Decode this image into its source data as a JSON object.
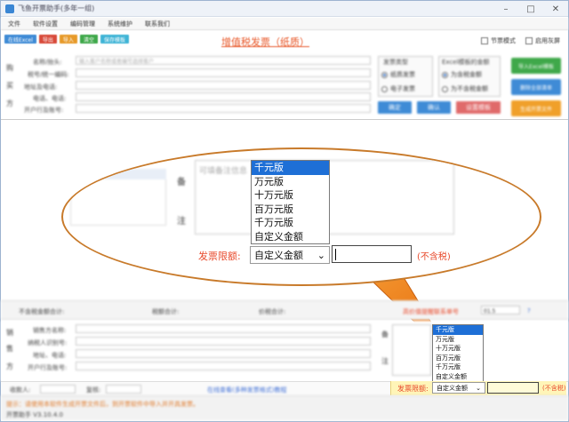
{
  "window": {
    "title": "飞鱼开票助手(多年一组)"
  },
  "menu": [
    "文件",
    "软件设置",
    "编码管理",
    "系统维护",
    "联系我们"
  ],
  "toolbar": [
    {
      "label": "在线Excel",
      "color": "#3f8bd6"
    },
    {
      "label": "导出",
      "color": "#d84a3a"
    },
    {
      "label": "导入",
      "color": "#e79a2a"
    },
    {
      "label": "清空",
      "color": "#3fa84a"
    },
    {
      "label": "保存模板",
      "color": "#3fb4d6"
    }
  ],
  "heading": "增值税发票（纸质）",
  "checkboxes": [
    "节票模式",
    "启用灰屏"
  ],
  "buyer": {
    "side_chars": [
      "购",
      "买",
      "方"
    ],
    "labels": [
      "名称/抬头:",
      "税号/统一编码:",
      "地址及电话:",
      "电话、电话:",
      "开户行及账号:"
    ],
    "name_placeholder": "输入客户名称或者编号选择客户"
  },
  "invoice_type": {
    "title": "发票类型",
    "options": [
      "纸质发票",
      "电子发票"
    ]
  },
  "excel_amount": {
    "title": "Excel模板的金额",
    "options": [
      "为含税金额",
      "为不含税金额"
    ]
  },
  "action_buttons": [
    "确定",
    "确认",
    "设置模板"
  ],
  "right_buttons": [
    {
      "label": "导入Excel模板",
      "color": "#3fa84a"
    },
    {
      "label": "删除全部清单",
      "color": "#3f8bd6"
    },
    {
      "label": "生成开票文件",
      "color": "#f0a02a"
    }
  ],
  "remark": {
    "side_chars": [
      "备",
      "注"
    ],
    "placeholder": "可填备注信息"
  },
  "limit": {
    "label": "发票限额:",
    "selected": "自定义金额",
    "options": [
      "千元版",
      "万元版",
      "十万元版",
      "百万元版",
      "千万元版",
      "自定义金额"
    ],
    "note": "(不含税)"
  },
  "status": {
    "left": "不含税金额合计:",
    "middle": "税额合计:",
    "right": "价税合计:",
    "check": "高价值提醒联系单号",
    "check_value": "01.5"
  },
  "seller": {
    "side_chars": [
      "销",
      "售",
      "方"
    ],
    "labels": [
      "销售方名称:",
      "纳税人识别号:",
      "地址、电话:",
      "开户行及账号:"
    ]
  },
  "bottom": {
    "payee": "收款人:",
    "reviewer": "复核:",
    "link": "在线查看(多种发票格式)教程"
  },
  "footer": {
    "notice": "提示：请使用本软件生成开票文件后，到开票软件中导入并开具发票。",
    "version": "开票助手 V3.10.4.0"
  }
}
